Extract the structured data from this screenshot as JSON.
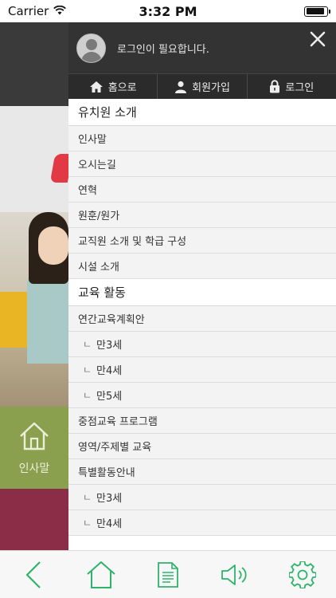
{
  "status_bar": {
    "carrier": "Carrier",
    "time": "3:32 PM",
    "battery_level": 0.9
  },
  "background_page": {
    "tile_label": "인사말",
    "tile_icon": "home-outline-icon",
    "colors": {
      "header": "#3a3a3a",
      "tile_green": "#8ba04e",
      "tile_maroon": "#8b2d47",
      "banner_accent": "#e23a45"
    }
  },
  "drawer": {
    "login_message": "로그인이 필요합니다.",
    "close_icon": "close-icon",
    "nav": [
      {
        "label": "홈으로",
        "icon": "home-icon"
      },
      {
        "label": "회원가입",
        "icon": "user-icon"
      },
      {
        "label": "로그인",
        "icon": "lock-icon"
      }
    ],
    "menu": [
      {
        "label": "유치원 소개",
        "kind": "section"
      },
      {
        "label": "인사말",
        "kind": "item"
      },
      {
        "label": "오시는길",
        "kind": "item"
      },
      {
        "label": "연혁",
        "kind": "item"
      },
      {
        "label": "원훈/원가",
        "kind": "item"
      },
      {
        "label": "교직원 소개 및 학급 구성",
        "kind": "item"
      },
      {
        "label": "시설 소개",
        "kind": "item"
      },
      {
        "label": "교육 활동",
        "kind": "section"
      },
      {
        "label": "연간교육계획안",
        "kind": "item"
      },
      {
        "label": "만3세",
        "kind": "sub"
      },
      {
        "label": "만4세",
        "kind": "sub"
      },
      {
        "label": "만5세",
        "kind": "sub"
      },
      {
        "label": "중점교육 프로그램",
        "kind": "item"
      },
      {
        "label": "영역/주제별 교육",
        "kind": "item"
      },
      {
        "label": "특별활동안내",
        "kind": "item"
      },
      {
        "label": "만3세",
        "kind": "sub"
      },
      {
        "label": "만4세",
        "kind": "sub"
      }
    ],
    "sub_prefix": "ㄴ"
  },
  "toolbar": {
    "accent": "#2fb36b",
    "items": [
      "back-icon",
      "home-icon",
      "document-icon",
      "speaker-icon",
      "settings-icon"
    ]
  }
}
